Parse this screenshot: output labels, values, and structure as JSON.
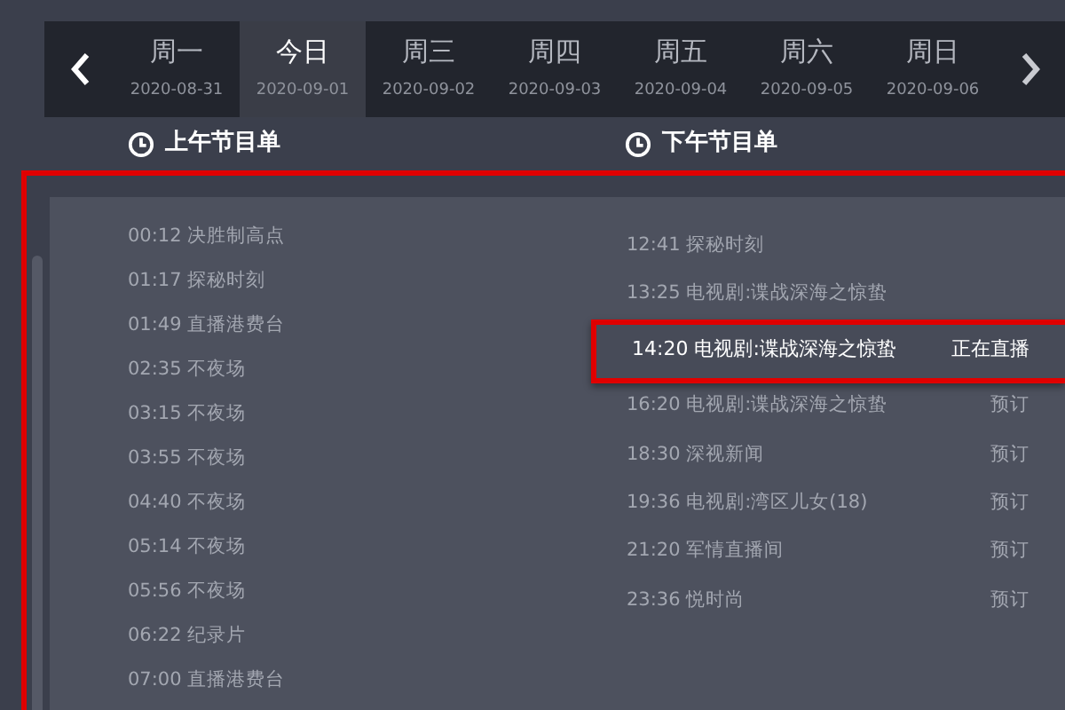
{
  "days": [
    {
      "label": "周一",
      "date": "2020-08-31",
      "selected": false
    },
    {
      "label": "今日",
      "date": "2020-09-01",
      "selected": true
    },
    {
      "label": "周三",
      "date": "2020-09-02",
      "selected": false
    },
    {
      "label": "周四",
      "date": "2020-09-03",
      "selected": false
    },
    {
      "label": "周五",
      "date": "2020-09-04",
      "selected": false
    },
    {
      "label": "周六",
      "date": "2020-09-05",
      "selected": false
    },
    {
      "label": "周日",
      "date": "2020-09-06",
      "selected": false
    }
  ],
  "morning": {
    "title": "上午节目单",
    "items": [
      {
        "time": "00:12",
        "title": "决胜制高点"
      },
      {
        "time": "01:17",
        "title": "探秘时刻"
      },
      {
        "time": "01:49",
        "title": "直播港费台"
      },
      {
        "time": "02:35",
        "title": "不夜场"
      },
      {
        "time": "03:15",
        "title": "不夜场"
      },
      {
        "time": "03:55",
        "title": "不夜场"
      },
      {
        "time": "04:40",
        "title": "不夜场"
      },
      {
        "time": "05:14",
        "title": "不夜场"
      },
      {
        "time": "05:56",
        "title": "不夜场"
      },
      {
        "time": "06:22",
        "title": "纪录片"
      },
      {
        "time": "07:00",
        "title": "直播港费台"
      }
    ]
  },
  "afternoon": {
    "title": "下午节目单",
    "items": [
      {
        "time": "12:41",
        "title": "探秘时刻",
        "selected": false
      },
      {
        "time": "13:25",
        "title": "电视剧:谍战深海之惊蛰",
        "selected": false
      },
      {
        "time": "14:20",
        "title": "电视剧:谍战深海之惊蛰",
        "status": "正在直播",
        "selected": true
      },
      {
        "time": "16:20",
        "title": "电视剧:谍战深海之惊蛰",
        "status": "预订",
        "selected": false
      },
      {
        "time": "18:30",
        "title": "深视新闻",
        "status": "预订",
        "selected": false
      },
      {
        "time": "19:36",
        "title": "电视剧:湾区儿女(18)",
        "status": "预订",
        "selected": false
      },
      {
        "time": "21:20",
        "title": "军情直播间",
        "status": "预订",
        "selected": false
      },
      {
        "time": "23:36",
        "title": "悦时尚",
        "status": "预订",
        "selected": false
      }
    ]
  }
}
